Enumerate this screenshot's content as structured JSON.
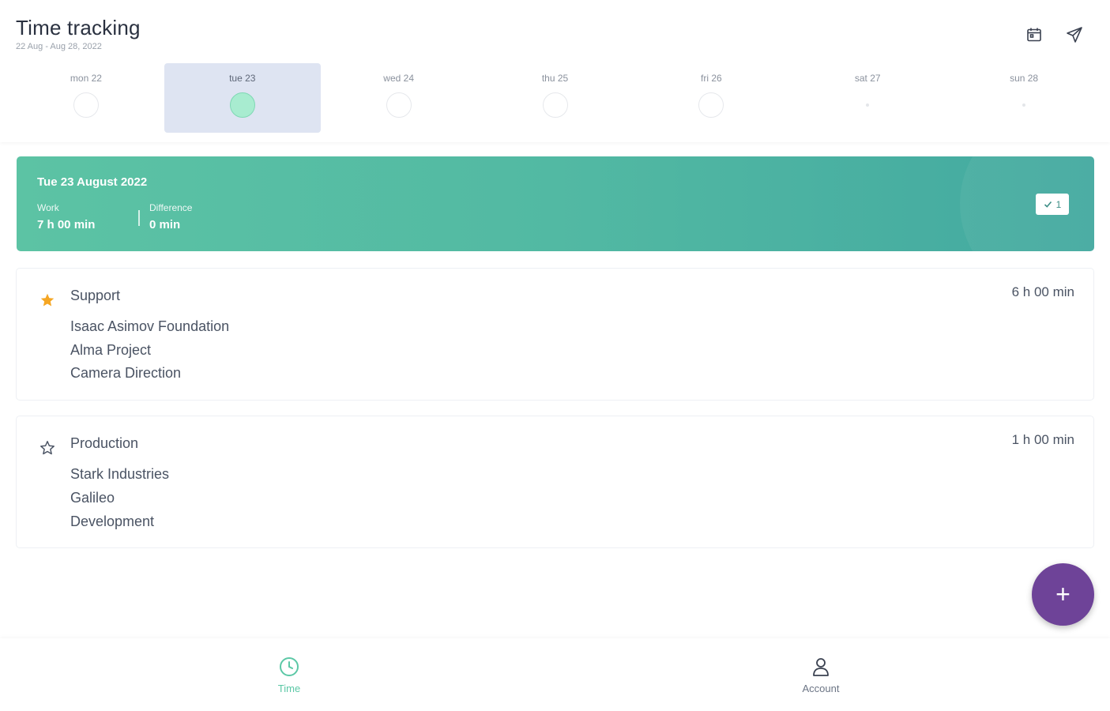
{
  "header": {
    "title": "Time tracking",
    "date_range": "22 Aug - Aug 28, 2022",
    "calendar_icon": "calendar-icon",
    "send_icon": "send-icon"
  },
  "week": {
    "days": [
      {
        "label": "mon 22",
        "state": "empty"
      },
      {
        "label": "tue 23",
        "state": "complete",
        "selected": true
      },
      {
        "label": "wed 24",
        "state": "empty"
      },
      {
        "label": "thu 25",
        "state": "empty"
      },
      {
        "label": "fri 26",
        "state": "empty"
      },
      {
        "label": "sat 27",
        "state": "weekend"
      },
      {
        "label": "sun 28",
        "state": "weekend"
      }
    ]
  },
  "summary": {
    "date": "Tue 23 August 2022",
    "work_label": "Work",
    "work_value": "7 h 00 min",
    "difference_label": "Difference",
    "difference_value": "0 min",
    "badge_icon": "check-icon",
    "badge_count": "1"
  },
  "entries": [
    {
      "favorite": true,
      "category": "Support",
      "duration": "6 h 00 min",
      "customer": "Isaac Asimov Foundation",
      "project": "Alma Project",
      "task": "Camera Direction"
    },
    {
      "favorite": false,
      "category": "Production",
      "duration": "1 h 00 min",
      "customer": "Stark Industries",
      "project": "Galileo",
      "task": "Development"
    }
  ],
  "fab": {
    "icon": "plus",
    "label": "+"
  },
  "bottom_nav": {
    "items": [
      {
        "label": "Time",
        "icon": "clock-icon",
        "active": true
      },
      {
        "label": "Account",
        "icon": "user-icon",
        "active": false
      }
    ]
  },
  "colors": {
    "accent_green": "#5cc8a6",
    "banner_start": "#5cc3a4",
    "banner_end": "#43a9a0",
    "fab_purple": "#6e4398",
    "selected_day_bg": "#dee4f2",
    "star_orange": "#f5a623"
  }
}
